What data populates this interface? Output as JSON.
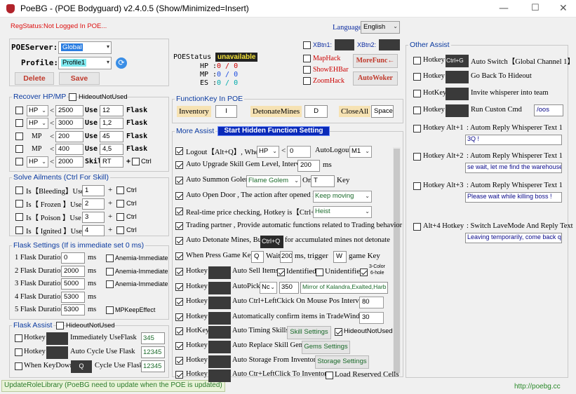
{
  "window": {
    "title": "PoeBG - (POE Bodyguard) v2.4.0.5  (Show/Minimized=Insert)",
    "min": "—",
    "max": "☐",
    "close": "✕"
  },
  "top": {
    "reg_label": "RegStatus:",
    "reg_value": "Not Logged In POE...",
    "language_label": "Language:",
    "language_value": "English"
  },
  "account": {
    "server_label": "POEServer:",
    "server_value": "Global",
    "profile_label": "Profile:",
    "profile_value": "Profile1",
    "delete": "Delete",
    "save": "Save"
  },
  "status": {
    "poestatus_label": "POEStatus :",
    "poestatus_value": "unavailable",
    "hp_label": "HP :",
    "hp_value": "0 / 0",
    "mp_label": "MP :",
    "mp_value": "0 / 0",
    "es_label": "ES :",
    "es_value": "0 / 0"
  },
  "xbtn": {
    "x1": "XBtn1:",
    "x2": "XBtn2:"
  },
  "hacks": {
    "maphack": "MapHack",
    "showehbar": "ShowEHBar",
    "zoomhack": "ZoomHack",
    "morefunc": "MoreFunc←",
    "autowoker": "AutoWoker"
  },
  "recover": {
    "title": "Recover HP/MP",
    "hide_label": "HideoutNotUsed",
    "rows": [
      {
        "type": "HP",
        "sel": true,
        "op": "<",
        "val": "2500",
        "use": "Use",
        "slot": "12",
        "kind": "Flask"
      },
      {
        "type": "HP",
        "sel": true,
        "op": "<",
        "val": "3000",
        "use": "Use",
        "slot": "1,2",
        "kind": "Flask"
      },
      {
        "type": "MP",
        "sel": false,
        "op": "<",
        "val": "200",
        "use": "Use",
        "slot": "45",
        "kind": "Flask"
      },
      {
        "type": "MP",
        "sel": false,
        "op": "<",
        "val": "400",
        "use": "Use",
        "slot": "4,5",
        "kind": "Flask"
      },
      {
        "type": "HP",
        "sel": true,
        "op": "<",
        "val": "2000",
        "use": "Skill",
        "slot": "RT",
        "kind": "+",
        "extra": "Ctrl"
      }
    ]
  },
  "ailments": {
    "title": "Solve Ailments (Ctrl For Skill)",
    "rows": [
      {
        "name": "Is【Bleeding】Use",
        "val": "1",
        "ctrl": "Ctrl"
      },
      {
        "name": "Is【 Frozen 】Use",
        "val": "2",
        "ctrl": "Ctrl"
      },
      {
        "name": "Is【 Poison 】Use",
        "val": "3",
        "ctrl": "Ctrl"
      },
      {
        "name": "Is【 Ignited 】Use",
        "val": "4",
        "ctrl": "Ctrl"
      }
    ],
    "plus": "+"
  },
  "flasksettings": {
    "title": "Flask Settings (If is immediate set 0 ms)",
    "unit": "ms",
    "rows": [
      {
        "label": "1 Flask Duration",
        "val": "0",
        "opt": "Anemia-Immediate"
      },
      {
        "label": "2 Flask Duration",
        "val": "2000",
        "opt": "Anemia-Immediate"
      },
      {
        "label": "3 Flask Duration",
        "val": "5000",
        "opt": "Anemia-Immediate"
      },
      {
        "label": "4 Flask Duration",
        "val": "5300",
        "opt": ""
      },
      {
        "label": "5 Flask Duration",
        "val": "5300",
        "opt": "MPKeepEffect"
      }
    ]
  },
  "flaskassist": {
    "title": "Flask Assist",
    "hide": "HideoutNotUsed",
    "rows": [
      {
        "label": "Hotkey",
        "desc": "Immediately UseFlask",
        "val": "345"
      },
      {
        "label": "Hotkey",
        "desc": "Auto Cycle Use Flask",
        "val": "12345"
      },
      {
        "label": "When KeyDown",
        "key": "Q",
        "desc": "Cycle Use Flask",
        "val": "12345"
      }
    ]
  },
  "functionkey": {
    "title": "FunctionKey In POE",
    "inventory_label": "Inventory",
    "inventory_key": "I",
    "detonate_label": "DetonateMines",
    "detonate_key": "D",
    "closeall_label": "CloseAll",
    "closeall_key": "Space"
  },
  "moreassist": {
    "title": "More Assist",
    "start_button": "Start Hidden Function Setting",
    "rows": [
      {
        "t": "Logout【Alt+Q】, When",
        "s1": "HP",
        "op": "<",
        "v1": "0",
        "t2": "AutoLogout",
        "s2": "M1"
      },
      {
        "t": "Auto Upgrade Skill Gem Level, Interval",
        "v1": "200",
        "t2": "ms"
      },
      {
        "t": "Auto Summon Golem",
        "s1": "Flame Golem",
        "t2": "On",
        "v1": "T",
        "t3": "Key"
      },
      {
        "t": "Auto Open Door , The action after opened is",
        "s1": "Keep moving"
      },
      {
        "t": "Real-time price checking, Hotkey is【Ctrl+C】",
        "s1": "Heist"
      },
      {
        "t": "Trading partner , Provide automatic functions related to Trading behavior"
      },
      {
        "t": "Auto Detonate Mines, But",
        "k": "Ctrl+Q",
        "t2": "for accumulated mines not detonate"
      },
      {
        "t": "When Press Game Key",
        "v1": "Q",
        "t2": "Wait",
        "v2": "200",
        "t3": "ms, trigger",
        "v3": "W",
        "t4": "game Key"
      },
      {
        "t": "Hotkey",
        "t2": "Auto Sell Items",
        "c1": "Identified",
        "c2": "Unidentified",
        "c3a": "3-Color",
        "c3b": "6-hole"
      },
      {
        "t": "Hotkey",
        "t2": "AutoPick",
        "s1": "Nc",
        "v1": "350",
        "v2": "Mirror of Kalandra,Exalted,Harb"
      },
      {
        "t": "Hotkey",
        "t2": "Auto Ctrl+LeftCkick On Mouse Pos Interval",
        "v1": "80"
      },
      {
        "t": "Hotkey",
        "t2": "Automatically confirm items in TradeWindow",
        "v1": "30"
      },
      {
        "t": "HotKey",
        "t2": "Auto Timing Skills",
        "b": "Skill Settings",
        "c1": "HideoutNotUsed"
      },
      {
        "t": "Hotkey",
        "t2": "Auto Replace Skill Gems",
        "b": "Gems Settings"
      },
      {
        "t": "Hotkey",
        "t2": "Auto Storage From Inventory",
        "b": "Storage Settings"
      },
      {
        "t": "Hotkey",
        "t2": "Auto Ctr+LeftClick To Inventory",
        "c1": "Load Reserved Cells"
      }
    ]
  },
  "other": {
    "title": "Other Assist",
    "rows": [
      {
        "label": "Hotkey",
        "key": "Ctrl+G",
        "desc": "Auto Switch【Global Channel 1】"
      },
      {
        "label": "Hotkey",
        "key": "",
        "desc": "Go Back To Hideout"
      },
      {
        "label": "HotKey",
        "key": "",
        "desc": "Invite whisperer into team"
      },
      {
        "label": "Hotkey",
        "key": "",
        "desc": "Run Custon Cmd",
        "val": "/oos"
      },
      {
        "label": "Hotkey Alt+1",
        "desc": ": Autom Reply Whisperer Text 1",
        "val": "3Q !"
      },
      {
        "label": "Hotkey Alt+2",
        "desc": ": Autom Reply Whisperer Text 1",
        "val": "se wait, let me find the warehouse !"
      },
      {
        "label": "Hotkey Alt+3",
        "desc": ": Autom Reply Whisperer Text 1",
        "val": "Please wait while killing boss !"
      },
      {
        "label": "Alt+4 Hotkey",
        "desc": ": Switch LaveMode And Reply Text",
        "val": "Leaving temporarily, come back qu"
      }
    ]
  },
  "footer": {
    "update": "UpdateRoleLibrary (PoeBG need to update when the POE is updated)",
    "url": "http://poebg.cc"
  }
}
